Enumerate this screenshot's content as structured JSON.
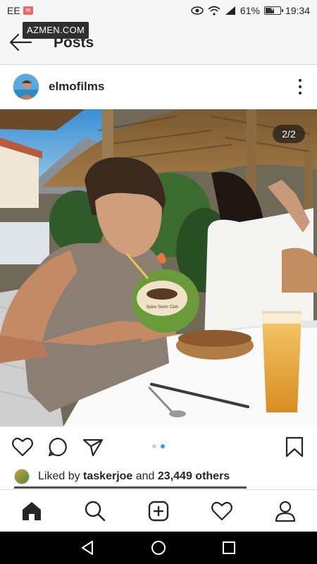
{
  "status_bar": {
    "carrier": "EE",
    "battery_percent": "61%",
    "battery_level": 0.61,
    "time": "19:34",
    "icons": [
      "eye-icon",
      "wifi-icon",
      "signal-icon",
      "battery-icon"
    ]
  },
  "watermark": "AZMEN.COM",
  "header": {
    "title": "Posts",
    "back_icon": "arrow-left-icon"
  },
  "post": {
    "username": "elmofilms",
    "image_counter": "2/2",
    "carousel": {
      "total": 2,
      "current": 2
    },
    "image_text": "Spice Swim Club"
  },
  "actions": {
    "icons": [
      "heart-outline-icon",
      "comment-icon",
      "share-icon",
      "bookmark-icon"
    ]
  },
  "likes": {
    "prefix": "Liked by ",
    "user": "taskerjoe",
    "middle": " and ",
    "count": "23,449 others"
  },
  "bottom_nav": {
    "items": [
      "home-icon",
      "search-icon",
      "add-post-icon",
      "activity-heart-icon",
      "profile-icon"
    ]
  },
  "system_nav": {
    "items": [
      "back-triangle-icon",
      "home-circle-icon",
      "recents-square-icon"
    ]
  },
  "colors": {
    "accent": "#3897f0",
    "text": "#262626",
    "border": "#dbdbdb"
  }
}
